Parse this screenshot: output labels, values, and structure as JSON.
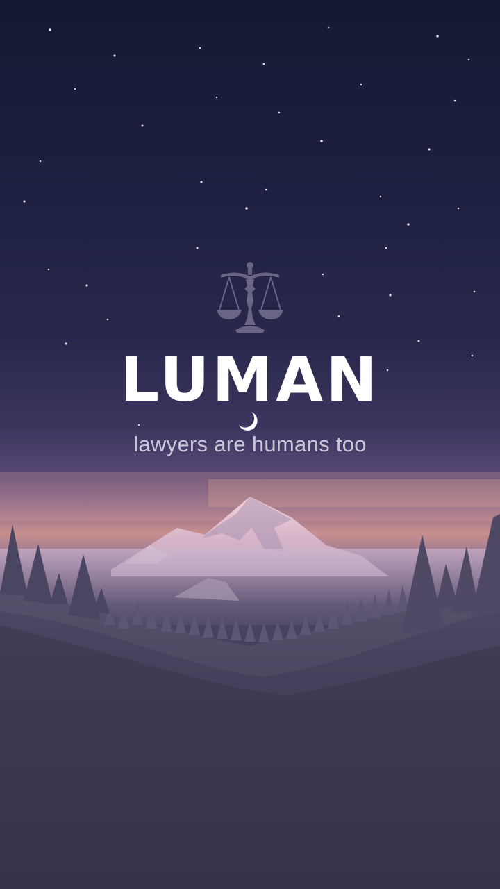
{
  "splash": {
    "app_name": "LUMAN",
    "tagline": "lawyers are humans too",
    "logo_icon": "scales-of-justice-icon",
    "moon_icon": "crescent-moon-icon"
  },
  "colors": {
    "sky_top": "#141a33",
    "horizon_glow": "#c98f8e",
    "ground": "#2f2e45",
    "title_text": "#ffffff",
    "tagline_text": "#c9c6d8",
    "logo": "#6b6585"
  }
}
